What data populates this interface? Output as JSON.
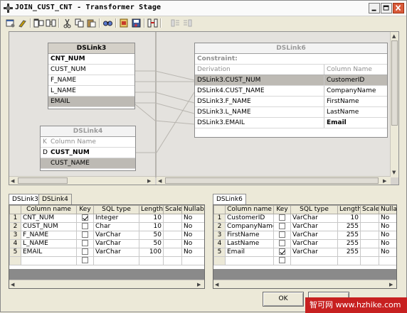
{
  "window": {
    "title": "JOIN_CUST_CNT - Transformer Stage"
  },
  "toolbar": {
    "icons": [
      "stage-properties-icon",
      "constraints-icon",
      "show-all-icon",
      "show-relations-icon",
      "cut-icon",
      "copy-icon",
      "paste-icon",
      "find-icon",
      "load-icon",
      "save-icon",
      "column-autoload-icon",
      "input-link-order-icon",
      "output-link-order-icon"
    ]
  },
  "canvas": {
    "input_links": [
      {
        "name": "DSLink3",
        "columns": [
          {
            "label": "CNT_NUM",
            "bold": true,
            "selected": false
          },
          {
            "label": "CUST_NUM",
            "bold": false,
            "selected": false
          },
          {
            "label": "F_NAME",
            "bold": false,
            "selected": false
          },
          {
            "label": "L_NAME",
            "bold": false,
            "selected": false
          },
          {
            "label": "EMAIL",
            "bold": false,
            "selected": true
          }
        ]
      },
      {
        "name": "DSLink4",
        "key_header": "K",
        "column_header": "Column Name",
        "columns": [
          {
            "key": "D",
            "label": "CUST_NUM",
            "bold": true,
            "selected": false
          },
          {
            "key": "",
            "label": "CUST_NAME",
            "bold": false,
            "selected": true
          }
        ]
      }
    ],
    "output_link": {
      "name": "DSLink6",
      "constraint_label": "Constraint:",
      "derivation_header": "Derivation",
      "column_header": "Column Name",
      "rows": [
        {
          "derivation": "DSLink3.CUST_NUM",
          "column": "CustomerID",
          "selected": true,
          "bold": false
        },
        {
          "derivation": "DSLink4.CUST_NAME",
          "column": "CompanyName",
          "selected": false,
          "bold": false
        },
        {
          "derivation": "DSLink3.F_NAME",
          "column": "FirstName",
          "selected": false,
          "bold": false
        },
        {
          "derivation": "DSLink3.L_NAME",
          "column": "LastName",
          "selected": false,
          "bold": false
        },
        {
          "derivation": "DSLink3.EMAIL",
          "column": "Email",
          "selected": false,
          "bold": true
        }
      ]
    }
  },
  "input_grid": {
    "tabs": [
      "DSLink3",
      "DSLink4"
    ],
    "active_tab": "DSLink3",
    "headers": [
      "",
      "Column name",
      "Key",
      "SQL type",
      "Length",
      "Scale",
      "Nullable"
    ],
    "rows": [
      {
        "n": "1",
        "name": "CNT_NUM",
        "key": true,
        "type": "Integer",
        "length": "10",
        "scale": "",
        "nullable": "No"
      },
      {
        "n": "2",
        "name": "CUST_NUM",
        "key": false,
        "type": "Char",
        "length": "10",
        "scale": "",
        "nullable": "No"
      },
      {
        "n": "3",
        "name": "F_NAME",
        "key": false,
        "type": "VarChar",
        "length": "50",
        "scale": "",
        "nullable": "No"
      },
      {
        "n": "4",
        "name": "L_NAME",
        "key": false,
        "type": "VarChar",
        "length": "50",
        "scale": "",
        "nullable": "No"
      },
      {
        "n": "5",
        "name": "EMAIL",
        "key": false,
        "type": "VarChar",
        "length": "100",
        "scale": "",
        "nullable": "No"
      }
    ]
  },
  "output_grid": {
    "tabs": [
      "DSLink6"
    ],
    "active_tab": "DSLink6",
    "headers": [
      "",
      "Column name",
      "Key",
      "SQL type",
      "Length",
      "Scale",
      "Nullab"
    ],
    "rows": [
      {
        "n": "1",
        "name": "CustomerID",
        "key": false,
        "type": "VarChar",
        "length": "10",
        "scale": "",
        "nullable": "No"
      },
      {
        "n": "2",
        "name": "CompanyName",
        "key": false,
        "type": "VarChar",
        "length": "255",
        "scale": "",
        "nullable": "No"
      },
      {
        "n": "3",
        "name": "FirstName",
        "key": false,
        "type": "VarChar",
        "length": "255",
        "scale": "",
        "nullable": "No"
      },
      {
        "n": "4",
        "name": "LastName",
        "key": false,
        "type": "VarChar",
        "length": "255",
        "scale": "",
        "nullable": "No"
      },
      {
        "n": "5",
        "name": "Email",
        "key": true,
        "type": "VarChar",
        "length": "255",
        "scale": "",
        "nullable": "No"
      }
    ]
  },
  "buttons": {
    "ok_label": "OK"
  },
  "watermark": {
    "text": "智可网 www.hzhike.com"
  }
}
